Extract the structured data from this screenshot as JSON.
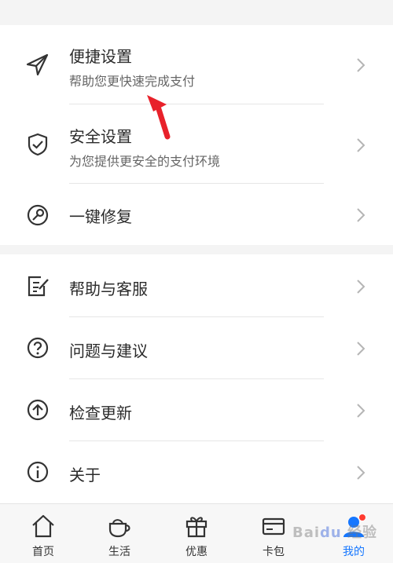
{
  "settings": {
    "items": [
      {
        "title": "便捷设置",
        "subtitle": "帮助您更快速完成支付",
        "icon": "send-icon"
      },
      {
        "title": "安全设置",
        "subtitle": "为您提供更安全的支付环境",
        "icon": "shield-check-icon"
      },
      {
        "title": "一键修复",
        "subtitle": "",
        "icon": "repair-icon"
      }
    ]
  },
  "support": {
    "items": [
      {
        "title": "帮助与客服",
        "icon": "edit-doc-icon"
      },
      {
        "title": "问题与建议",
        "icon": "question-icon"
      },
      {
        "title": "检查更新",
        "icon": "arrow-up-circle-icon"
      },
      {
        "title": "关于",
        "icon": "info-icon"
      }
    ]
  },
  "tabbar": {
    "tabs": [
      {
        "label": "首页",
        "icon": "home-icon"
      },
      {
        "label": "生活",
        "icon": "cup-icon"
      },
      {
        "label": "优惠",
        "icon": "gift-icon"
      },
      {
        "label": "卡包",
        "icon": "card-icon"
      },
      {
        "label": "我的",
        "icon": "user-icon",
        "active": true,
        "badge": true
      }
    ]
  },
  "colors": {
    "accent": "#1677ff",
    "badge": "#ff3b30",
    "annotation_arrow": "#e8212a"
  }
}
